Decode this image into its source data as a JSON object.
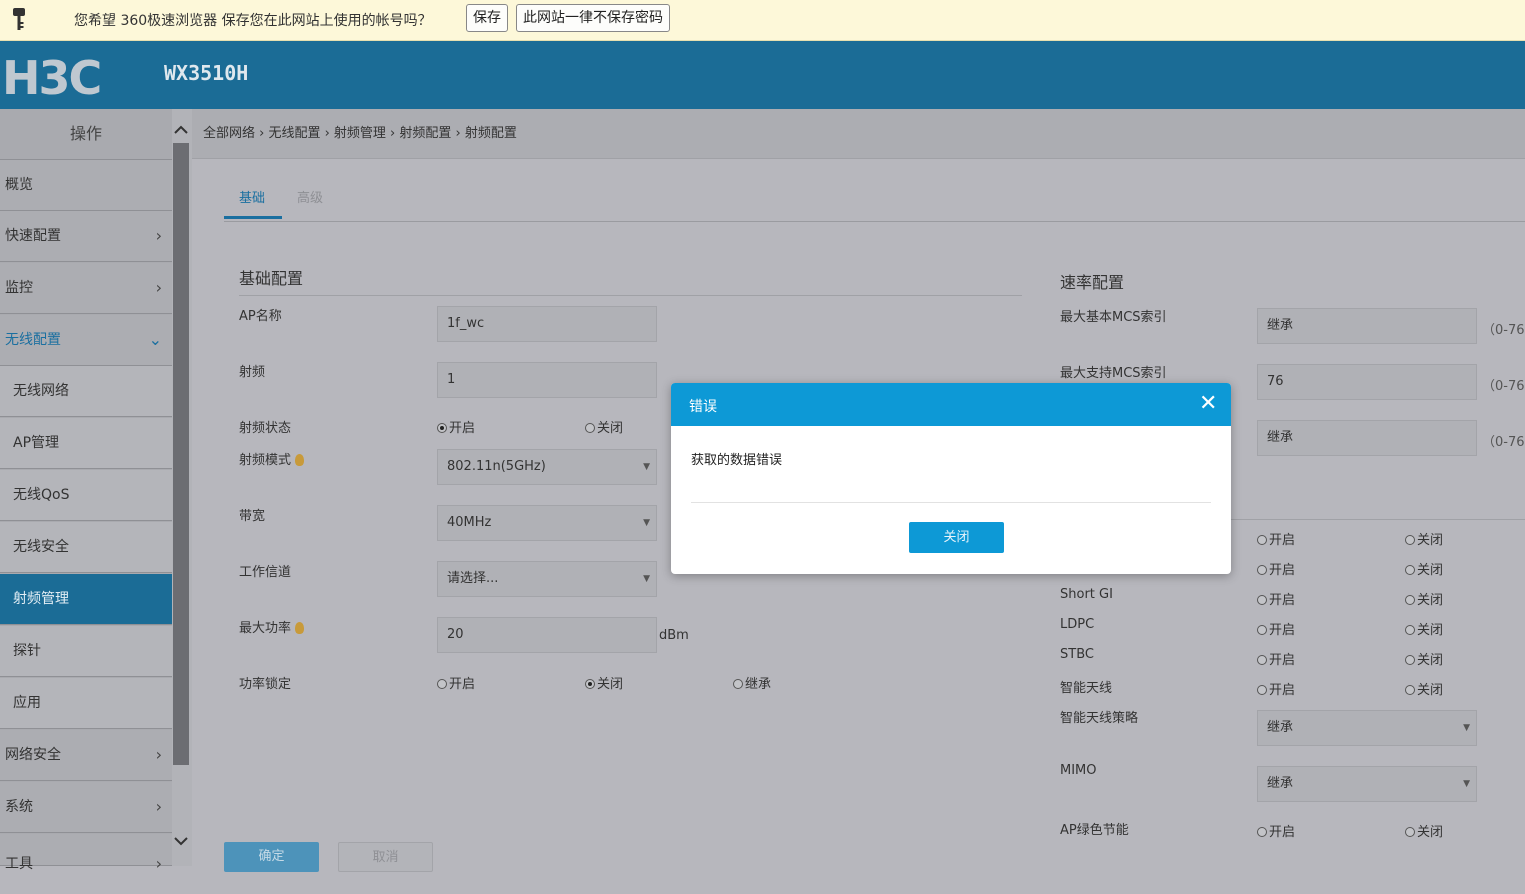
{
  "password_bar": {
    "message": "您希望 360极速浏览器 保存您在此网站上使用的帐号吗？",
    "save_label": "保存",
    "never_label": "此网站一律不保存密码"
  },
  "header": {
    "logo": "H3C",
    "model": "WX3510H"
  },
  "sidebar": {
    "title": "操作",
    "items": [
      {
        "label": "概览"
      },
      {
        "label": "快速配置",
        "chevron": "›"
      },
      {
        "label": "监控",
        "chevron": "›"
      },
      {
        "label": "无线配置",
        "chevron": "⌄"
      },
      {
        "label": "无线网络"
      },
      {
        "label": "AP管理"
      },
      {
        "label": "无线QoS"
      },
      {
        "label": "无线安全"
      },
      {
        "label": "射频管理"
      },
      {
        "label": "探针"
      },
      {
        "label": "应用"
      },
      {
        "label": "网络安全",
        "chevron": "›"
      },
      {
        "label": "系统",
        "chevron": "›"
      },
      {
        "label": "工具",
        "chevron": "›"
      }
    ]
  },
  "breadcrumb": "全部网络 › 无线配置 › 射频管理 › 射频配置 › 射频配置",
  "tabs": [
    {
      "label": "基础"
    },
    {
      "label": "高级"
    }
  ],
  "basic": {
    "title": "基础配置",
    "ap_name_label": "AP名称",
    "ap_name_value": "1f_wc",
    "radio_label": "射频",
    "radio_value": "1",
    "radio_state_label": "射频状态",
    "on": "开启",
    "off": "关闭",
    "radio_mode_label": "射频模式",
    "radio_mode_value": "802.11n(5GHz)",
    "bandwidth_label": "带宽",
    "bandwidth_value": "40MHz",
    "channel_label": "工作信道",
    "channel_value": "请选择...",
    "max_power_label": "最大功率",
    "max_power_value": "20",
    "max_power_unit": "dBm",
    "power_lock_label": "功率锁定",
    "inherit": "继承"
  },
  "rate": {
    "title": "速率配置",
    "max_basic_mcs_label": "最大基本MCS索引",
    "max_basic_mcs_value": "继承",
    "range": "（0-76",
    "max_support_mcs_label": "最大支持MCS索引",
    "max_support_mcs_value": "76",
    "third_value": "继承",
    "short_gi_label": "Short GI",
    "ldpc_label": "LDPC",
    "stbc_label": "STBC",
    "smart_ant_label": "智能天线",
    "smart_ant_policy_label": "智能天线策略",
    "smart_ant_policy_value": "继承",
    "mimo_label": "MIMO",
    "mimo_value": "继承",
    "ap_green_label": "AP绿色节能",
    "on": "开启",
    "off": "关闭"
  },
  "buttons": {
    "confirm": "确定",
    "cancel": "取消"
  },
  "modal": {
    "title": "错误",
    "message": "获取的数据错误",
    "close_label": "关闭",
    "close_icon": "✕"
  }
}
